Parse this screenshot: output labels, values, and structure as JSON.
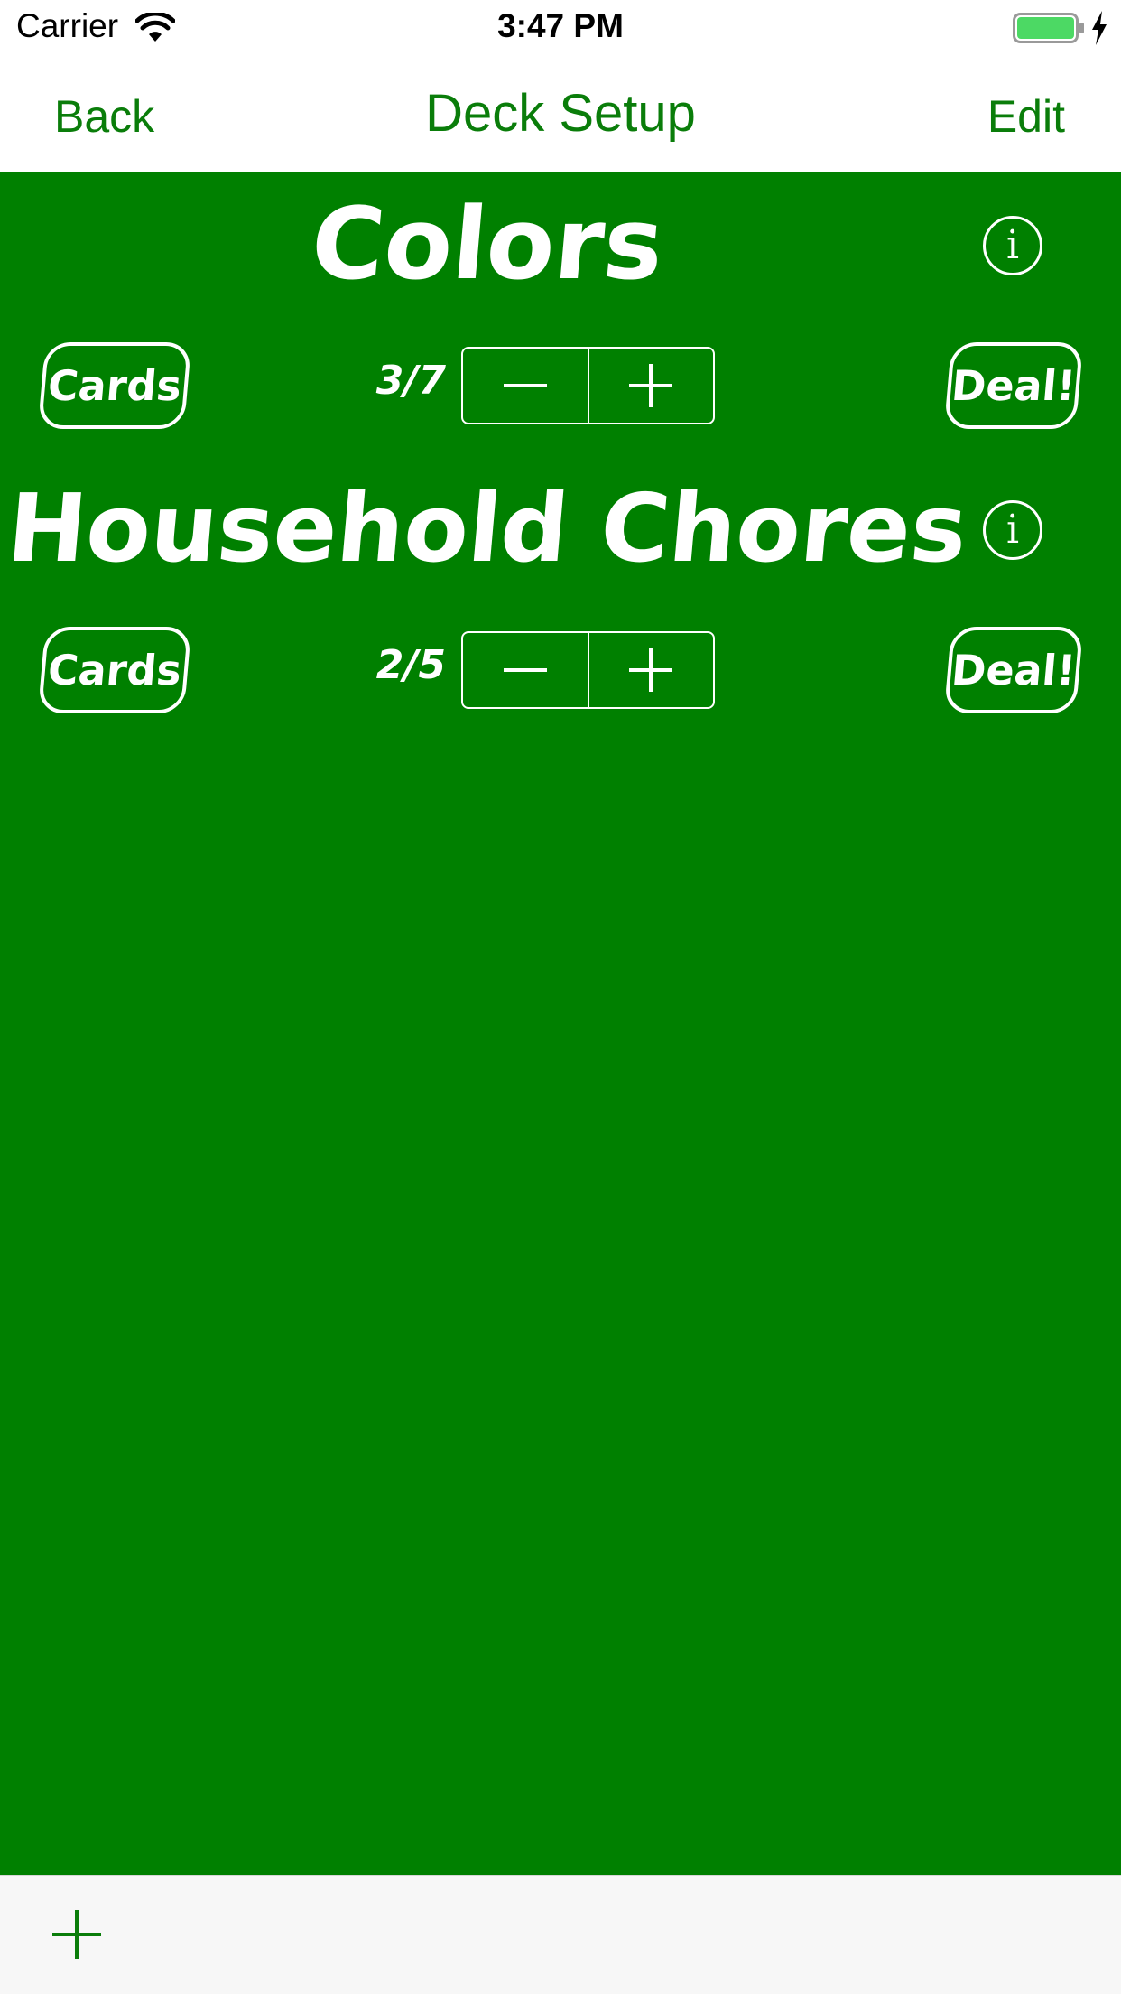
{
  "status_bar": {
    "carrier": "Carrier",
    "time": "3:47 PM",
    "wifi_icon": "wifi-icon",
    "battery_icon": "battery-icon",
    "charging_icon": "charging-bolt-icon",
    "battery_color": "#4cd964"
  },
  "nav": {
    "back_label": "Back",
    "title": "Deck Setup",
    "edit_label": "Edit",
    "tint_color": "#0a7d0a"
  },
  "content": {
    "background_color": "#008000",
    "decks": [
      {
        "title": "Colors",
        "info_glyph": "i",
        "cards_label": "Cards",
        "count": "3/7",
        "minus_glyph": "minus-icon",
        "plus_glyph": "plus-icon",
        "deal_label": "Deal!"
      },
      {
        "title": "Household Chores",
        "info_glyph": "i",
        "cards_label": "Cards",
        "count": "2/5",
        "minus_glyph": "minus-icon",
        "plus_glyph": "plus-icon",
        "deal_label": "Deal!"
      }
    ]
  },
  "toolbar": {
    "add_icon": "add-icon"
  }
}
